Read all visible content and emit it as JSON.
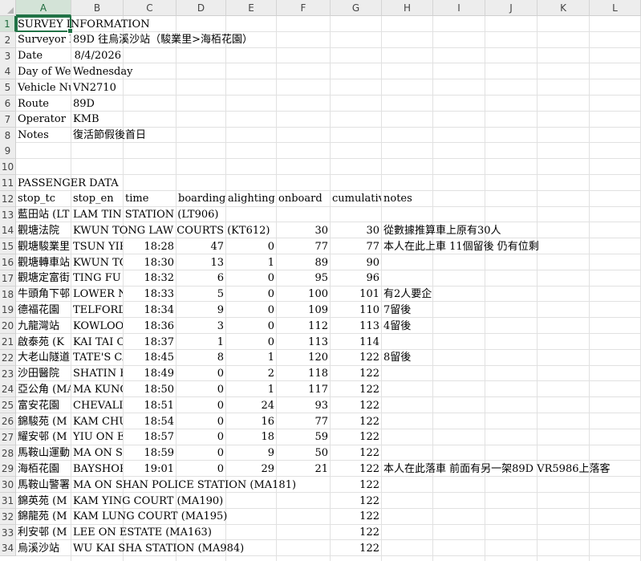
{
  "columns": [
    "A",
    "B",
    "C",
    "D",
    "E",
    "F",
    "G",
    "H",
    "I",
    "J",
    "K",
    "L"
  ],
  "selected_cell": {
    "col": "A",
    "row": 1
  },
  "rows": [
    {
      "n": 1,
      "cells": {
        "A": "SURVEY INFORMATION"
      }
    },
    {
      "n": 2,
      "cells": {
        "A": "Surveyor N",
        "B": "89D 往烏溪沙站（駿業里>海栢花園）"
      }
    },
    {
      "n": 3,
      "cells": {
        "A": "Date",
        "B": "8/4/2026"
      }
    },
    {
      "n": 4,
      "cells": {
        "A": "Day of Wee",
        "B": "Wednesday"
      }
    },
    {
      "n": 5,
      "cells": {
        "A": "Vehicle Nu",
        "B": "VN2710"
      }
    },
    {
      "n": 6,
      "cells": {
        "A": "Route",
        "B": "89D"
      }
    },
    {
      "n": 7,
      "cells": {
        "A": "Operator",
        "B": "KMB"
      }
    },
    {
      "n": 8,
      "cells": {
        "A": "Notes",
        "B": "復活節假後首日"
      }
    },
    {
      "n": 9,
      "cells": {}
    },
    {
      "n": 10,
      "cells": {}
    },
    {
      "n": 11,
      "cells": {
        "A": "PASSENGER DATA"
      }
    },
    {
      "n": 12,
      "cells": {
        "A": "stop_tc",
        "B": "stop_en",
        "C": "time",
        "D": "boarding",
        "E": "alighting",
        "F": "onboard",
        "G": "cumulative_",
        "H": "notes"
      }
    },
    {
      "n": 13,
      "cells": {
        "A": "藍田站 (LT",
        "B": "LAM TIN STATION (LT906)"
      }
    },
    {
      "n": 14,
      "cells": {
        "A": "觀塘法院",
        "B": "KWUN TONG LAW COURTS (KT612)",
        "F": "30",
        "G": "30",
        "H": "從數據推算車上原有30人"
      }
    },
    {
      "n": 15,
      "cells": {
        "A": "觀塘駿業里",
        "B": "TSUN YIP",
        "C": "18:28",
        "D": "47",
        "E": "0",
        "F": "77",
        "G": "77",
        "H": "本人在此上車 11個留後 仍有位剩"
      }
    },
    {
      "n": 16,
      "cells": {
        "A": "觀塘轉車站",
        "B": "KWUN TO",
        "C": "18:30",
        "D": "13",
        "E": "1",
        "F": "89",
        "G": "90"
      }
    },
    {
      "n": 17,
      "cells": {
        "A": "觀塘定富街",
        "B": "TING FU S",
        "C": "18:32",
        "D": "6",
        "E": "0",
        "F": "95",
        "G": "96"
      }
    },
    {
      "n": 18,
      "cells": {
        "A": "牛頭角下邨",
        "B": "LOWER NG",
        "C": "18:33",
        "D": "5",
        "E": "0",
        "F": "100",
        "G": "101",
        "H": "有2人要企"
      }
    },
    {
      "n": 19,
      "cells": {
        "A": "德福花園",
        "B": "TELFORD",
        "C": "18:34",
        "D": "9",
        "E": "0",
        "F": "109",
        "G": "110",
        "H": "7留後"
      }
    },
    {
      "n": 20,
      "cells": {
        "A": "九龍灣站",
        "B": "KOWLOOI",
        "C": "18:36",
        "D": "3",
        "E": "0",
        "F": "112",
        "G": "113",
        "H": "4留後"
      }
    },
    {
      "n": 21,
      "cells": {
        "A": "啟泰苑 (K",
        "B": "KAI TAI C",
        "C": "18:37",
        "D": "1",
        "E": "0",
        "F": "113",
        "G": "114"
      }
    },
    {
      "n": 22,
      "cells": {
        "A": "大老山隧道",
        "B": "TATE'S CA",
        "C": "18:45",
        "D": "8",
        "E": "1",
        "F": "120",
        "G": "122",
        "H": "8留後"
      }
    },
    {
      "n": 23,
      "cells": {
        "A": "沙田醫院",
        "B": "SHATIN H",
        "C": "18:49",
        "D": "0",
        "E": "2",
        "F": "118",
        "G": "122"
      }
    },
    {
      "n": 24,
      "cells": {
        "A": "亞公角 (MA",
        "B": "MA KUNG K",
        "C": "18:50",
        "D": "0",
        "E": "1",
        "F": "117",
        "G": "122"
      }
    },
    {
      "n": 25,
      "cells": {
        "A": "富安花園",
        "B": "CHEVALIE",
        "C": "18:51",
        "D": "0",
        "E": "24",
        "F": "93",
        "G": "122"
      }
    },
    {
      "n": 26,
      "cells": {
        "A": "錦駿苑 (M",
        "B": "KAM CHU",
        "C": "18:54",
        "D": "0",
        "E": "16",
        "F": "77",
        "G": "122"
      }
    },
    {
      "n": 27,
      "cells": {
        "A": "耀安邨 (M",
        "B": "YIU ON ES",
        "C": "18:57",
        "D": "0",
        "E": "18",
        "F": "59",
        "G": "122"
      }
    },
    {
      "n": 28,
      "cells": {
        "A": "馬鞍山運動",
        "B": "MA ON SH",
        "C": "18:59",
        "D": "0",
        "E": "9",
        "F": "50",
        "G": "122"
      }
    },
    {
      "n": 29,
      "cells": {
        "A": "海栢花園",
        "B": "BAYSHOR",
        "C": "19:01",
        "D": "0",
        "E": "29",
        "F": "21",
        "G": "122",
        "H": "本人在此落車 前面有另一架89D VR5986上落客"
      }
    },
    {
      "n": 30,
      "cells": {
        "A": "馬鞍山警署",
        "B": "MA ON SHAN POLICE STATION (MA181)",
        "G": "122"
      }
    },
    {
      "n": 31,
      "cells": {
        "A": "錦英苑 (M",
        "B": "KAM YING COURT (MA190)",
        "G": "122"
      }
    },
    {
      "n": 32,
      "cells": {
        "A": "錦龍苑 (M",
        "B": "KAM LUNG COURT (MA195)",
        "G": "122"
      }
    },
    {
      "n": 33,
      "cells": {
        "A": "利安邨 (M",
        "B": "LEE ON ESTATE (MA163)",
        "G": "122"
      }
    },
    {
      "n": 34,
      "cells": {
        "A": "烏溪沙站",
        "B": "WU KAI SHA STATION (MA984)",
        "G": "122"
      }
    }
  ]
}
